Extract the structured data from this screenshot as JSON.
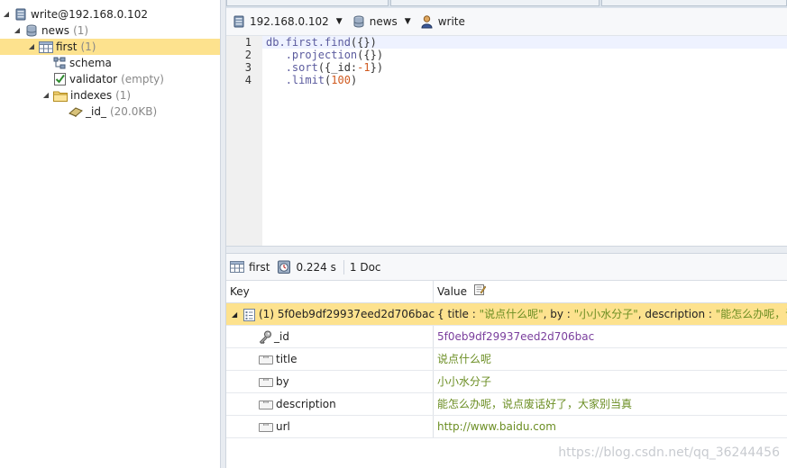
{
  "tree": {
    "connection": "write@192.168.0.102",
    "database": {
      "label": "news",
      "count": "(1)"
    },
    "collection": {
      "label": "first",
      "count": "(1)"
    },
    "schema": "schema",
    "validator": {
      "label": "validator",
      "extra": "(empty)"
    },
    "indexes": {
      "label": "indexes",
      "count": "(1)"
    },
    "index_id": {
      "label": "_id_",
      "size": "(20.0KB)"
    }
  },
  "toolbar": {
    "server": "192.168.0.102",
    "database": "news",
    "user": "write"
  },
  "editor": {
    "line_numbers": [
      "1",
      "2",
      "3",
      "4"
    ]
  },
  "results_toolbar": {
    "collection": "first",
    "time": "0.224 s",
    "docs": "1 Doc"
  },
  "grid": {
    "key_header": "Key",
    "value_header": "Value",
    "doc_key": "(1) 5f0eb9df29937eed2d706bac",
    "doc_value_prefix": "{ title : ",
    "doc_title": "\"说点什么呢\"",
    "doc_by_label": ", by : ",
    "doc_by": "\"小小水分子\"",
    "doc_desc_label": ", description : ",
    "doc_desc": "\"能怎么办呢，说点",
    "fields": [
      {
        "key": "_id",
        "value": "5f0eb9df29937eed2d706bac"
      },
      {
        "key": "title",
        "value": "说点什么呢"
      },
      {
        "key": "by",
        "value": "小小水分子"
      },
      {
        "key": "description",
        "value": "能怎么办呢，说点废话好了，大家别当真"
      },
      {
        "key": "url",
        "value": "http://www.baidu.com"
      }
    ]
  },
  "watermark": "https://blog.csdn.net/qq_36244456",
  "colors": {
    "selection": "#fde28e",
    "string_value": "#6b8e23",
    "id_value": "#7a3e9d",
    "keyword": "#5b5b9e",
    "number": "#d05a1f"
  }
}
